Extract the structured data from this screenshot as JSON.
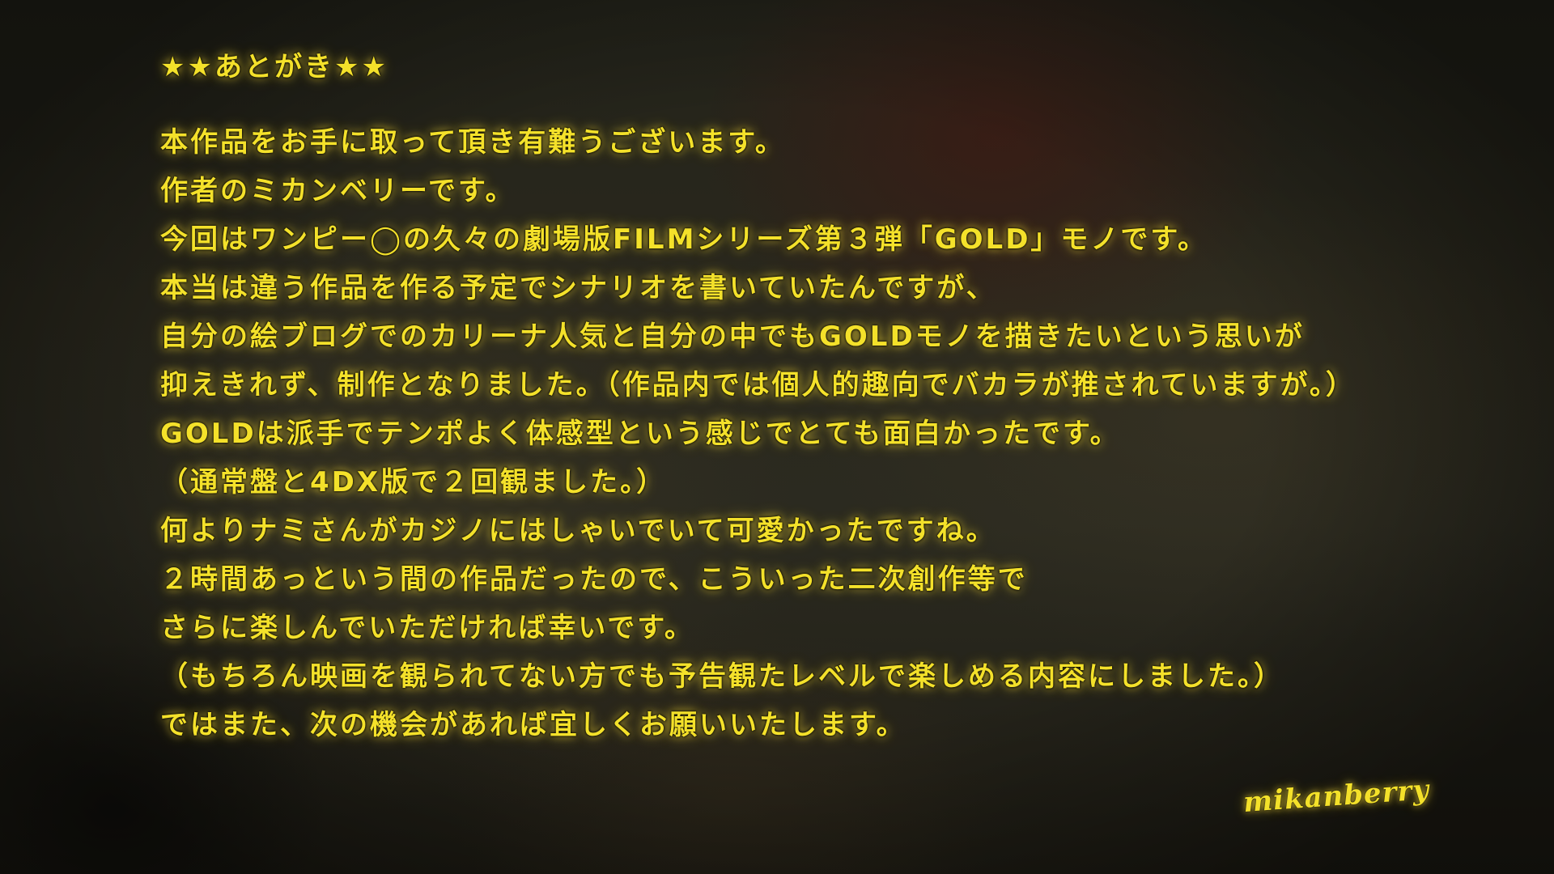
{
  "afterword": {
    "heading": "★★あとがき★★",
    "lines": [
      "本作品をお手に取って頂き有難うございます。",
      "作者のミカンベリーです。",
      "今回はワンピー◯の久々の劇場版FILMシリーズ第３弾「GOLD」モノです。",
      "本当は違う作品を作る予定でシナリオを書いていたんですが、",
      "自分の絵ブログでのカリーナ人気と自分の中でもGOLDモノを描きたいという思いが",
      "抑えきれず、制作となりました。（作品内では個人的趣向でバカラが推されていますが。）",
      "GOLDは派手でテンポよく体感型という感じでとても面白かったです。",
      "（通常盤と4DX版で２回観ました。）",
      "何よりナミさんがカジノにはしゃいでいて可愛かったですね。",
      "２時間あっという間の作品だったので、こういった二次創作等で",
      "さらに楽しんでいただければ幸いです。",
      "（もちろん映画を観られてない方でも予告観たレベルで楽しめる内容にしました。）",
      "ではまた、次の機会があれば宜しくお願いいたします。"
    ],
    "signature": "mikanberry"
  },
  "colors": {
    "text": "#f4e12a",
    "glow": "#ffe63c",
    "background": "#2a281d"
  }
}
